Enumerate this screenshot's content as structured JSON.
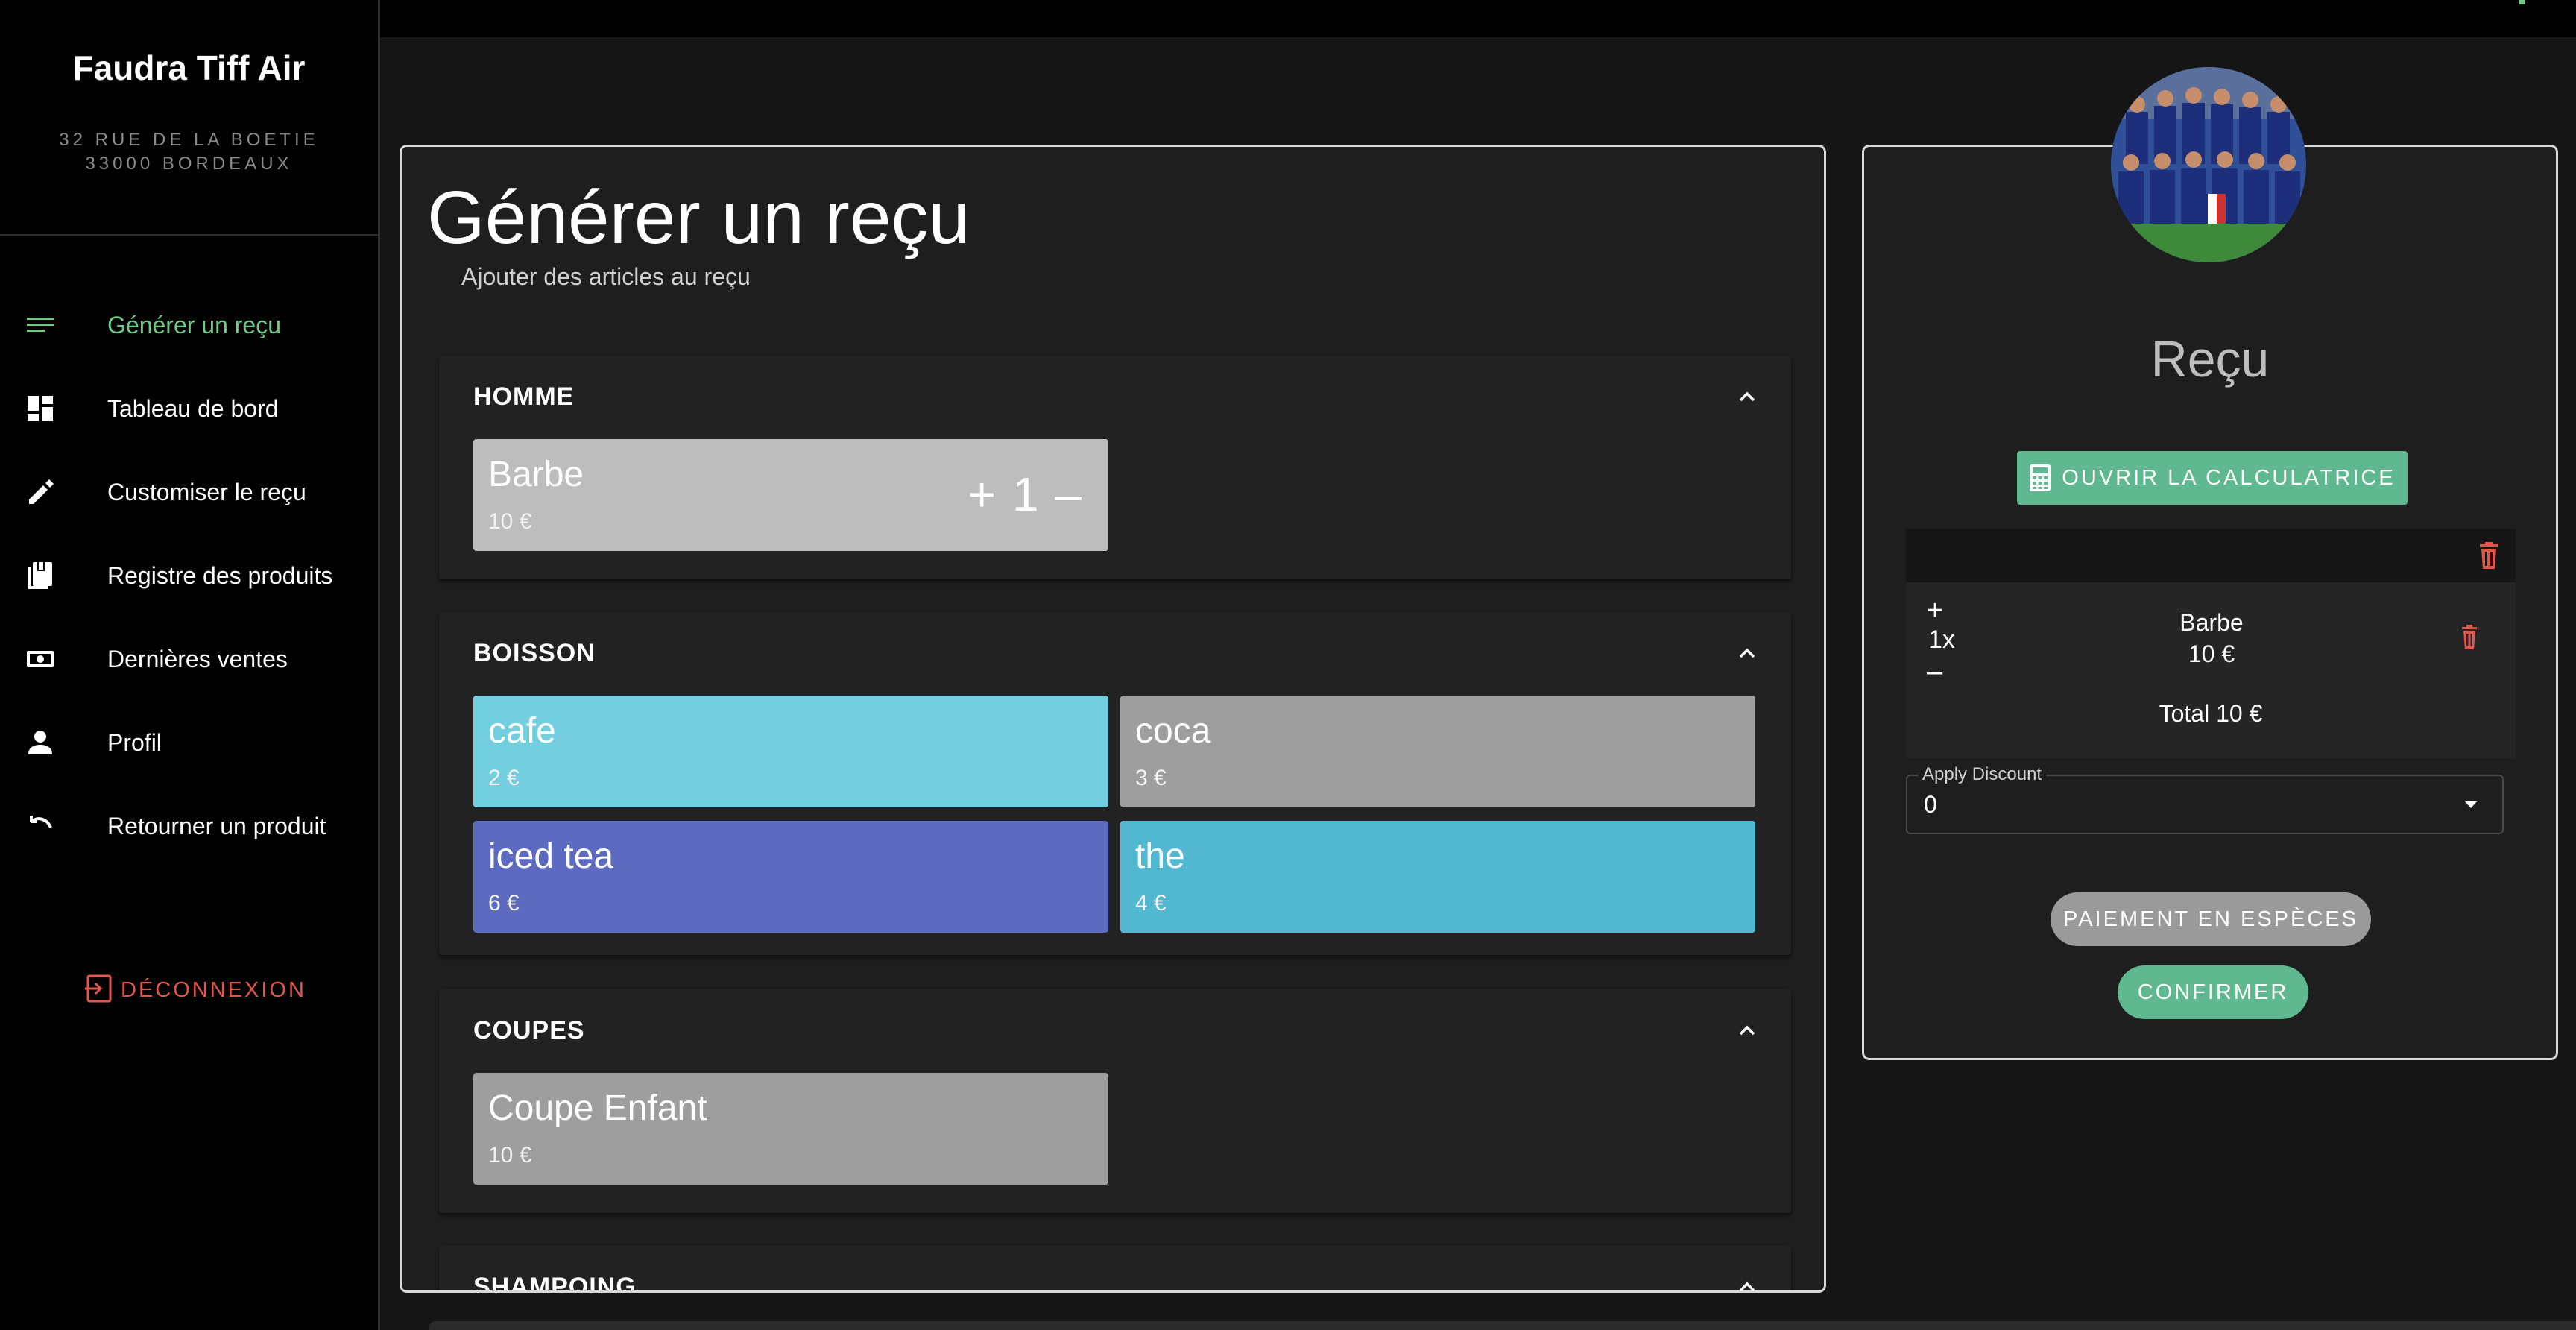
{
  "brand": {
    "name": "Faudra Tiff Air",
    "address_line1": "32 RUE DE LA BOETIE",
    "address_line2": "33000 BORDEAUX"
  },
  "nav": {
    "items": [
      {
        "label": "Générer un reçu",
        "icon": "receipt-lines-icon",
        "active": true
      },
      {
        "label": "Tableau de bord",
        "icon": "dashboard-icon",
        "active": false
      },
      {
        "label": "Customiser le reçu",
        "icon": "pencil-icon",
        "active": false
      },
      {
        "label": "Registre des produits",
        "icon": "product-register-icon",
        "active": false
      },
      {
        "label": "Dernières ventes",
        "icon": "banknote-icon",
        "active": false
      },
      {
        "label": "Profil",
        "icon": "person-icon",
        "active": false
      },
      {
        "label": "Retourner un produit",
        "icon": "undo-icon",
        "active": false
      }
    ],
    "logout_label": "DÉCONNEXION"
  },
  "main": {
    "title": "Générer un reçu",
    "subtitle": "Ajouter des articles au reçu",
    "categories": [
      {
        "name": "HOMME",
        "products": [
          {
            "name": "Barbe",
            "price": "10 €",
            "color": "#bdbdbd",
            "qty_plus": "+",
            "qty": "1",
            "qty_minus": "–"
          }
        ]
      },
      {
        "name": "BOISSON",
        "products": [
          {
            "name": "cafe",
            "price": "2 €",
            "color": "#73cfe0"
          },
          {
            "name": "coca",
            "price": "3 €",
            "color": "#9e9e9e"
          },
          {
            "name": "iced tea",
            "price": "6 €",
            "color": "#5c6bc0"
          },
          {
            "name": "the",
            "price": "4 €",
            "color": "#52b7d1"
          }
        ]
      },
      {
        "name": "COUPES",
        "products": [
          {
            "name": "Coupe Enfant",
            "price": "10 €",
            "color": "#9e9e9e"
          }
        ]
      },
      {
        "name": "SHAMPOING",
        "products": []
      }
    ]
  },
  "receipt": {
    "title": "Reçu",
    "calculator_label": "OUVRIR LA CALCULATRICE",
    "line": {
      "plus": "+",
      "qty": "1x",
      "minus": "–",
      "name": "Barbe",
      "price": "10 €"
    },
    "total": "Total 10 €",
    "discount_label": "Apply Discount",
    "discount_value": "0",
    "cash_label": "PAIEMENT EN ESPÈCES",
    "confirm_label": "CONFIRMER"
  },
  "colors": {
    "accent_green": "#5fb88f",
    "active_nav": "#72c987",
    "logout_red": "#e2574c",
    "trash_red": "#e2574c"
  }
}
